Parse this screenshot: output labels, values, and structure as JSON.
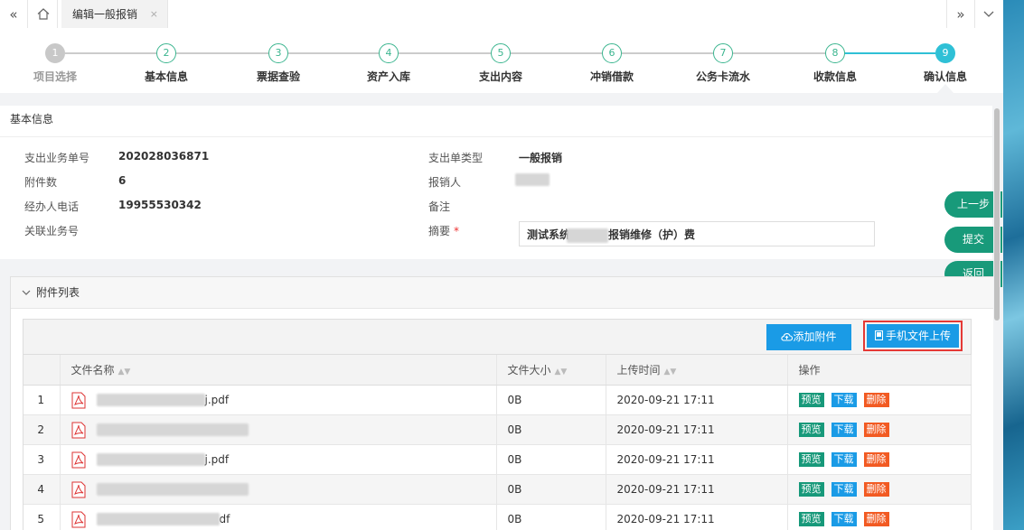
{
  "tabbar": {
    "tab_label": "编辑一般报销",
    "close": "×"
  },
  "steps": [
    {
      "num": "1",
      "label": "项目选择",
      "state": "done"
    },
    {
      "num": "2",
      "label": "基本信息",
      "state": "todo"
    },
    {
      "num": "3",
      "label": "票据查验",
      "state": "todo"
    },
    {
      "num": "4",
      "label": "资产入库",
      "state": "todo"
    },
    {
      "num": "5",
      "label": "支出内容",
      "state": "todo"
    },
    {
      "num": "6",
      "label": "冲销借款",
      "state": "todo"
    },
    {
      "num": "7",
      "label": "公务卡流水",
      "state": "todo"
    },
    {
      "num": "8",
      "label": "收款信息",
      "state": "todo"
    },
    {
      "num": "9",
      "label": "确认信息",
      "state": "active"
    }
  ],
  "basic": {
    "title": "基本信息",
    "order_no_label": "支出业务单号",
    "order_no": "202028036871",
    "attach_count_label": "附件数",
    "attach_count": "6",
    "phone_label": "经办人电话",
    "phone": "19955530342",
    "related_label": "关联业务号",
    "type_label": "支出单类型",
    "type": "一般报销",
    "reimburser_label": "报销人",
    "remark_label": "备注",
    "summary_label": "摘要",
    "required_mark": "*",
    "summary_prefix": "测试系统",
    "summary_suffix": "报销维修（护）费"
  },
  "float_buttons": {
    "prev": "上一步",
    "submit": "提交",
    "back": "返回"
  },
  "attachments": {
    "title": "附件列表",
    "add_label": "添加附件",
    "phone_upload_label": "手机文件上传",
    "columns": {
      "name": "文件名称",
      "size": "文件大小",
      "time": "上传时间",
      "ops": "操作"
    },
    "op_labels": {
      "preview": "预览",
      "download": "下载",
      "delete": "删除"
    },
    "rows": [
      {
        "idx": "1",
        "name_tail": "j.pdf",
        "size": "0B",
        "time": "2020-09-21 17:11"
      },
      {
        "idx": "2",
        "name_tail": "",
        "size": "0B",
        "time": "2020-09-21 17:11"
      },
      {
        "idx": "3",
        "name_tail": "j.pdf",
        "size": "0B",
        "time": "2020-09-21 17:11"
      },
      {
        "idx": "4",
        "name_tail": "",
        "size": "0B",
        "time": "2020-09-21 17:11"
      },
      {
        "idx": "5",
        "name_tail": "df",
        "size": "0B",
        "time": "2020-09-21 17:11"
      }
    ]
  },
  "colors": {
    "accent": "#189a7a",
    "step_active": "#2fc0d6",
    "primary_btn": "#1a9be6",
    "delete": "#f25a22",
    "highlight": "#e53935"
  }
}
